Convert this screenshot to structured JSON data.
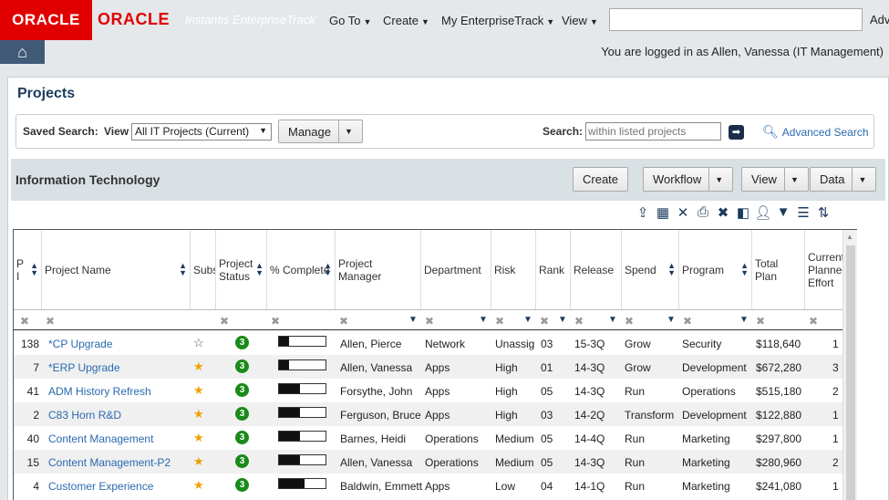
{
  "header": {
    "oracle_badge": "ORACLE",
    "oracle_logo": "ORACLE",
    "product_name": "Instantis EnterpriseTrack",
    "nav": [
      "Go To",
      "Create",
      "My EnterpriseTrack",
      "View"
    ],
    "search_value": "",
    "adv_label": "Adv",
    "login_text": "You are logged in as Allen, Vanessa (IT Management)"
  },
  "page": {
    "title": "Projects"
  },
  "saved_search": {
    "label": "Saved Search:",
    "view_label": "View",
    "view_value": "All IT Projects (Current)",
    "manage_label": "Manage",
    "search_label": "Search:",
    "search_placeholder": "within listed projects",
    "advanced_search": "Advanced Search"
  },
  "section": {
    "title": "Information Technology",
    "buttons": [
      "Create",
      "Workflow",
      "View",
      "Data"
    ]
  },
  "grid": {
    "columns": [
      "P\nI",
      "Project Name",
      "Subs",
      "Project Status",
      "% Complete",
      "Project Manager",
      "Department",
      "Risk",
      "Rank",
      "Release",
      "Spend",
      "Program",
      "Total Plan",
      "Current Planned Effort"
    ],
    "rows": [
      {
        "id": "138",
        "name": "*CP Upgrade",
        "starred": false,
        "status": "3",
        "complete": 0.22,
        "manager": "Allen, Pierce",
        "dept": "Network",
        "risk": "Unassigned",
        "rank": "03",
        "release": "15-3Q",
        "spend": "Grow",
        "program": "Security",
        "total": "$118,640",
        "effort": "1"
      },
      {
        "id": "7",
        "name": "*ERP Upgrade",
        "starred": true,
        "status": "3",
        "complete": 0.22,
        "manager": "Allen, Vanessa",
        "dept": "Apps",
        "risk": "High",
        "rank": "01",
        "release": "14-3Q",
        "spend": "Grow",
        "program": "Development",
        "total": "$672,280",
        "effort": "3"
      },
      {
        "id": "41",
        "name": "ADM History Refresh",
        "starred": true,
        "status": "3",
        "complete": 0.45,
        "manager": "Forsythe, John",
        "dept": "Apps",
        "risk": "High",
        "rank": "05",
        "release": "14-3Q",
        "spend": "Run",
        "program": "Operations",
        "total": "$515,180",
        "effort": "2"
      },
      {
        "id": "2",
        "name": "C83 Horn R&D",
        "starred": true,
        "status": "3",
        "complete": 0.45,
        "manager": "Ferguson, Bruce",
        "dept": "Apps",
        "risk": "High",
        "rank": "03",
        "release": "14-2Q",
        "spend": "Transform",
        "program": "Development",
        "total": "$122,880",
        "effort": "1"
      },
      {
        "id": "40",
        "name": "Content Management",
        "starred": true,
        "status": "3",
        "complete": 0.45,
        "manager": "Barnes, Heidi",
        "dept": "Operations",
        "risk": "Medium",
        "rank": "05",
        "release": "14-4Q",
        "spend": "Run",
        "program": "Marketing",
        "total": "$297,800",
        "effort": "1"
      },
      {
        "id": "15",
        "name": "Content Management-P2",
        "starred": true,
        "status": "3",
        "complete": 0.45,
        "manager": "Allen, Vanessa",
        "dept": "Operations",
        "risk": "Medium",
        "rank": "05",
        "release": "14-3Q",
        "spend": "Run",
        "program": "Marketing",
        "total": "$280,960",
        "effort": "2"
      },
      {
        "id": "4",
        "name": "Customer Experience",
        "starred": true,
        "status": "3",
        "complete": 0.55,
        "manager": "Baldwin, Emmett",
        "dept": "Apps",
        "risk": "Low",
        "rank": "04",
        "release": "14-1Q",
        "spend": "Run",
        "program": "Marketing",
        "total": "$241,080",
        "effort": "1"
      }
    ]
  }
}
